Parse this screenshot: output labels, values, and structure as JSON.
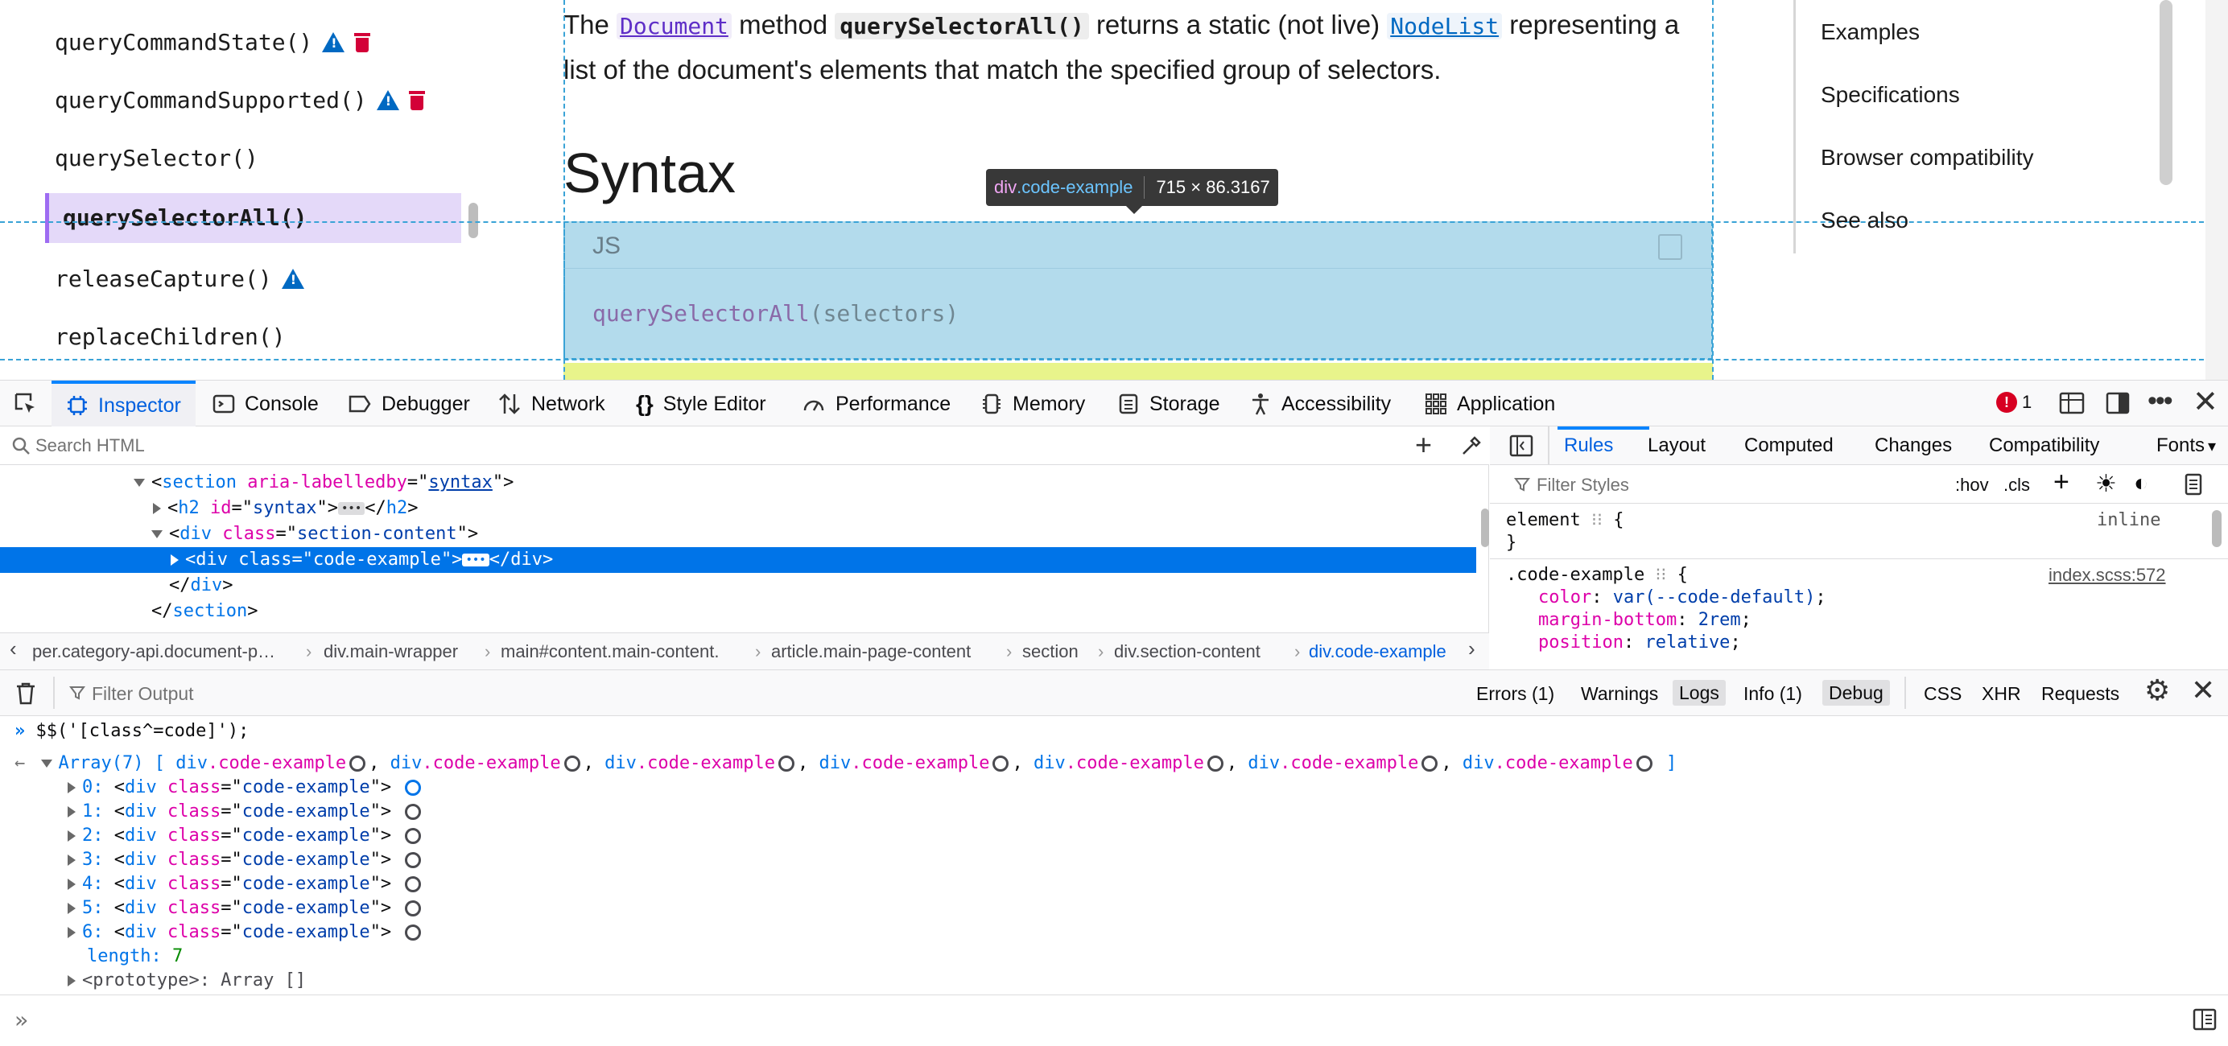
{
  "sidebar": {
    "items": [
      {
        "label": "queryCommandState()"
      },
      {
        "label": "queryCommandSupported()"
      },
      {
        "label": "querySelector()"
      },
      {
        "label": "querySelectorAll()"
      },
      {
        "label": "releaseCapture()"
      },
      {
        "label": "replaceChildren()"
      }
    ]
  },
  "article": {
    "intro_the": "The",
    "intro_document": "Document",
    "intro_method": "method",
    "intro_qsa": "querySelectorAll()",
    "intro_returns": "returns a static (not live)",
    "intro_nodelist": "NodeList",
    "intro_representing": "representing a",
    "intro_line2": "list of the document's elements that match the specified group of selectors.",
    "syntax_heading": "Syntax",
    "code_lang": "JS",
    "code_fn": "querySelectorAll",
    "code_open": "(",
    "code_arg": "selectors",
    "code_close": ")"
  },
  "tooltip": {
    "tag": "div",
    "class": ".code-example",
    "size": "715 × 86.3167"
  },
  "toc": {
    "items": [
      "Examples",
      "Specifications",
      "Browser compatibility",
      "See also"
    ]
  },
  "devtools": {
    "tabs": [
      "Inspector",
      "Console",
      "Debugger",
      "Network",
      "Style Editor",
      "Performance",
      "Memory",
      "Storage",
      "Accessibility",
      "Application"
    ],
    "error_count": "1",
    "search_placeholder": "Search HTML",
    "tree": {
      "l1_tag": "section",
      "l1_attr": "aria-labelledby",
      "l1_val": "syntax",
      "l2_tag": "h2",
      "l2_attr": "id",
      "l2_val": "syntax",
      "l3_tag": "div",
      "l3_attr": "class",
      "l3_val": "section-content",
      "l4_tag": "div",
      "l4_attr": "class",
      "l4_val": "code-example",
      "l5_close": "div",
      "l6_close": "section"
    },
    "breadcrumbs": [
      "per.category-api.document-p…",
      "div.main-wrapper",
      "main#content.main-content.",
      "article.main-page-content",
      "section",
      "div.section-content",
      "div.code-example"
    ],
    "rules_tabs": [
      "Rules",
      "Layout",
      "Computed",
      "Changes",
      "Compatibility",
      "Fonts"
    ],
    "rules_filter_placeholder": "Filter Styles",
    "hov": ":hov",
    "cls": ".cls",
    "rules": {
      "element_selector": "element",
      "element_source": "inline",
      "ce_selector": ".code-example",
      "ce_source": "index.scss:572",
      "decls": [
        {
          "prop": "color",
          "val": "var(--code-default)"
        },
        {
          "prop": "margin-bottom",
          "val": "2rem"
        },
        {
          "prop": "position",
          "val": "relative"
        }
      ]
    }
  },
  "console": {
    "filter_placeholder": "Filter Output",
    "filters": [
      "Errors (1)",
      "Warnings",
      "Logs",
      "Info (1)",
      "Debug",
      "CSS",
      "XHR",
      "Requests"
    ],
    "command": "$$('[class^=code]');",
    "array_label": "Array(7)",
    "items": [
      {
        "index": "0:"
      },
      {
        "index": "1:"
      },
      {
        "index": "2:"
      },
      {
        "index": "3:"
      },
      {
        "index": "4:"
      },
      {
        "index": "5:"
      },
      {
        "index": "6:"
      }
    ],
    "item_tag": "div",
    "item_attr": "class",
    "item_val": "code-example",
    "summary_el": "div",
    "summary_cls": ".code-example",
    "length_key": "length:",
    "length_val": "7",
    "prototype": "<prototype>: Array []"
  }
}
